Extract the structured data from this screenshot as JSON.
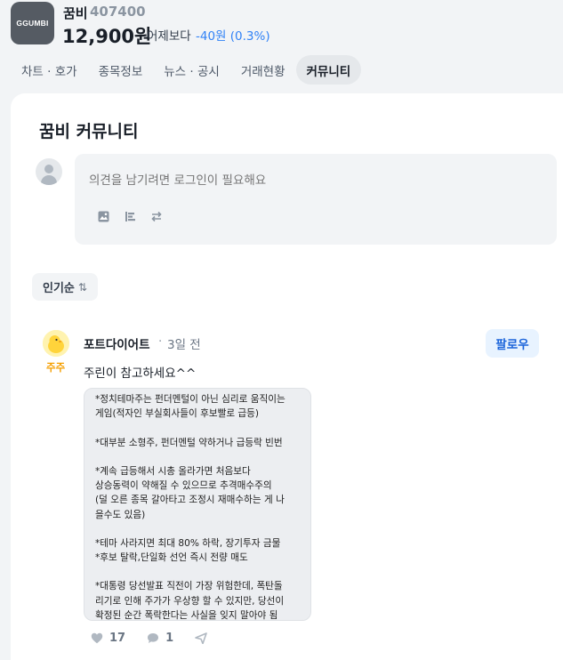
{
  "header": {
    "logo_text": "GGUMBI",
    "stock_name": "꿈비",
    "stock_code": "407400",
    "price": "12,900원",
    "vs_label": "어제보다",
    "change": "-40원 (0.3%)",
    "tabs": [
      {
        "label": "차트 · 호가"
      },
      {
        "label": "종목정보"
      },
      {
        "label": "뉴스 · 공시"
      },
      {
        "label": "거래현황"
      },
      {
        "label": "커뮤니티"
      }
    ]
  },
  "community": {
    "title": "꿈비 커뮤니티",
    "compose_placeholder": "의견을 남기려면 로그인이 필요해요",
    "compose_tools": [
      "image-icon",
      "chart-bar-icon",
      "repeat-icon"
    ],
    "sort_label": "인기순"
  },
  "post": {
    "badge": "주주",
    "author": "포트다이어트",
    "separator": "·",
    "time": "3일 전",
    "follow_label": "팔로우",
    "text": "주린이 참고하세요^^",
    "image_lines": [
      "*정치테마주는 펀더멘털이 아닌 심리로 움직이는",
      "게임(적자인 부실회사들이 후보빨로 급등)",
      "",
      "*대부분 소형주, 펀더멘털 약하거나  급등락 빈번",
      "",
      "*계속 급등해서 시총 올라가면 처음보다",
      "상승동력이 약해질 수 있으므로 추격매수주의",
      "(덜 오른 종목 갈아타고 조정시 재매수하는 게 나",
      "을수도 있음)",
      "",
      "*테마 사라지면 최대 80% 하락, 장기투자 금물",
      "*후보 탈락,단일화 선언 즉시 전량 매도",
      "",
      "*대통령 당선발표 직전이 가장 위험한데, 폭탄돌",
      "리기로 인해 주가가 우상향 할 수 있지만, 당선이",
      "확정된 순간 폭락한다는 사실을 잊지 말아야 됨"
    ],
    "likes": "17",
    "comments": "1"
  },
  "colors": {
    "accent": "#3182f6",
    "follow_text": "#1b64da",
    "badge": "#f59f00"
  }
}
